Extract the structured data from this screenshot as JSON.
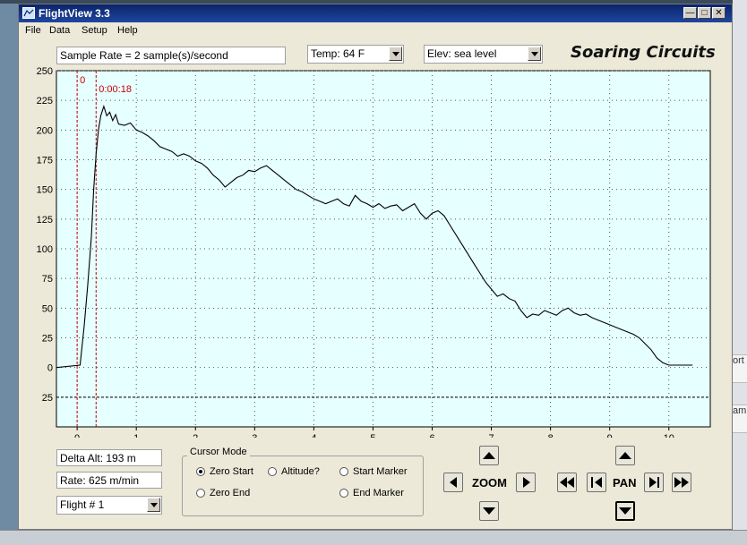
{
  "window": {
    "title": "FlightView 3.3"
  },
  "menu": [
    "File",
    "Data",
    "Setup",
    "Help"
  ],
  "toolbar": {
    "sample_rate": "Sample Rate =  2 sample(s)/second",
    "temp": "Temp:  64 F",
    "elev": "Elev: sea level",
    "brand": "Soaring Circuits"
  },
  "chart_data": {
    "type": "line",
    "y_ticks": [
      "250",
      "225",
      "200",
      "175",
      "150",
      "125",
      "100",
      "75",
      "50",
      "25",
      "0",
      "25"
    ],
    "x_ticks": [
      "0",
      "1",
      "2",
      "3",
      "4",
      "5",
      "6",
      "7",
      "8",
      "9",
      "10"
    ],
    "xlim": [
      -0.35,
      10.7
    ],
    "ylim": [
      -50,
      250
    ],
    "grid": true,
    "markers": [
      {
        "label": "0",
        "x": 0
      },
      {
        "label": "0:00:18",
        "x": 0.32
      }
    ],
    "x": [
      -0.35,
      0.05,
      0.12,
      0.18,
      0.24,
      0.28,
      0.32,
      0.36,
      0.4,
      0.45,
      0.5,
      0.55,
      0.6,
      0.65,
      0.7,
      0.8,
      0.9,
      1.0,
      1.1,
      1.2,
      1.3,
      1.4,
      1.5,
      1.6,
      1.7,
      1.8,
      1.9,
      2.0,
      2.1,
      2.2,
      2.3,
      2.4,
      2.5,
      2.6,
      2.7,
      2.8,
      2.9,
      3.0,
      3.1,
      3.2,
      3.3,
      3.4,
      3.5,
      3.6,
      3.7,
      3.8,
      3.9,
      4.0,
      4.1,
      4.2,
      4.3,
      4.4,
      4.5,
      4.6,
      4.7,
      4.8,
      4.9,
      5.0,
      5.1,
      5.2,
      5.3,
      5.4,
      5.5,
      5.6,
      5.7,
      5.8,
      5.9,
      6.0,
      6.1,
      6.2,
      6.3,
      6.4,
      6.5,
      6.6,
      6.7,
      6.8,
      6.9,
      7.0,
      7.1,
      7.2,
      7.3,
      7.4,
      7.5,
      7.6,
      7.7,
      7.8,
      7.9,
      8.0,
      8.1,
      8.2,
      8.3,
      8.4,
      8.5,
      8.6,
      8.7,
      8.8,
      8.9,
      9.0,
      9.1,
      9.2,
      9.3,
      9.4,
      9.5,
      9.6,
      9.7,
      9.8,
      9.9,
      10.0,
      10.1,
      10.2,
      10.3,
      10.4
    ],
    "y": [
      0,
      2,
      35,
      70,
      110,
      150,
      180,
      200,
      212,
      220,
      212,
      215,
      208,
      213,
      205,
      204,
      206,
      200,
      198,
      195,
      191,
      186,
      184,
      182,
      178,
      180,
      178,
      174,
      172,
      168,
      162,
      158,
      152,
      156,
      160,
      162,
      166,
      165,
      168,
      170,
      166,
      162,
      158,
      154,
      150,
      148,
      145,
      142,
      140,
      138,
      140,
      142,
      138,
      136,
      145,
      140,
      138,
      135,
      138,
      134,
      136,
      137,
      132,
      135,
      138,
      130,
      125,
      130,
      132,
      128,
      120,
      112,
      104,
      96,
      88,
      80,
      72,
      66,
      60,
      62,
      58,
      56,
      48,
      42,
      45,
      44,
      48,
      46,
      44,
      48,
      50,
      46,
      44,
      45,
      42,
      40,
      38,
      36,
      34,
      32,
      30,
      28,
      25,
      20,
      15,
      8,
      4,
      2,
      2,
      2,
      2,
      2
    ]
  },
  "bottom": {
    "delta_alt": "Delta Alt: 193 m",
    "rate": "Rate: 625 m/min",
    "flight": "Flight # 1",
    "cursor_mode": {
      "title": "Cursor Mode",
      "options": [
        "Zero Start",
        "Altitude?",
        "Start Marker",
        "Zero End",
        "End Marker"
      ],
      "selected": "Zero Start"
    },
    "zoom_label": "ZOOM",
    "pan_label": "PAN"
  },
  "desktop": {
    "fragment1": "ort",
    "fragment2": "am"
  },
  "colors": {
    "plot_bg": "#e6ffff",
    "marker": "#cc0000",
    "title_bar": "#0a246a",
    "window_bg": "#ece9d8"
  }
}
